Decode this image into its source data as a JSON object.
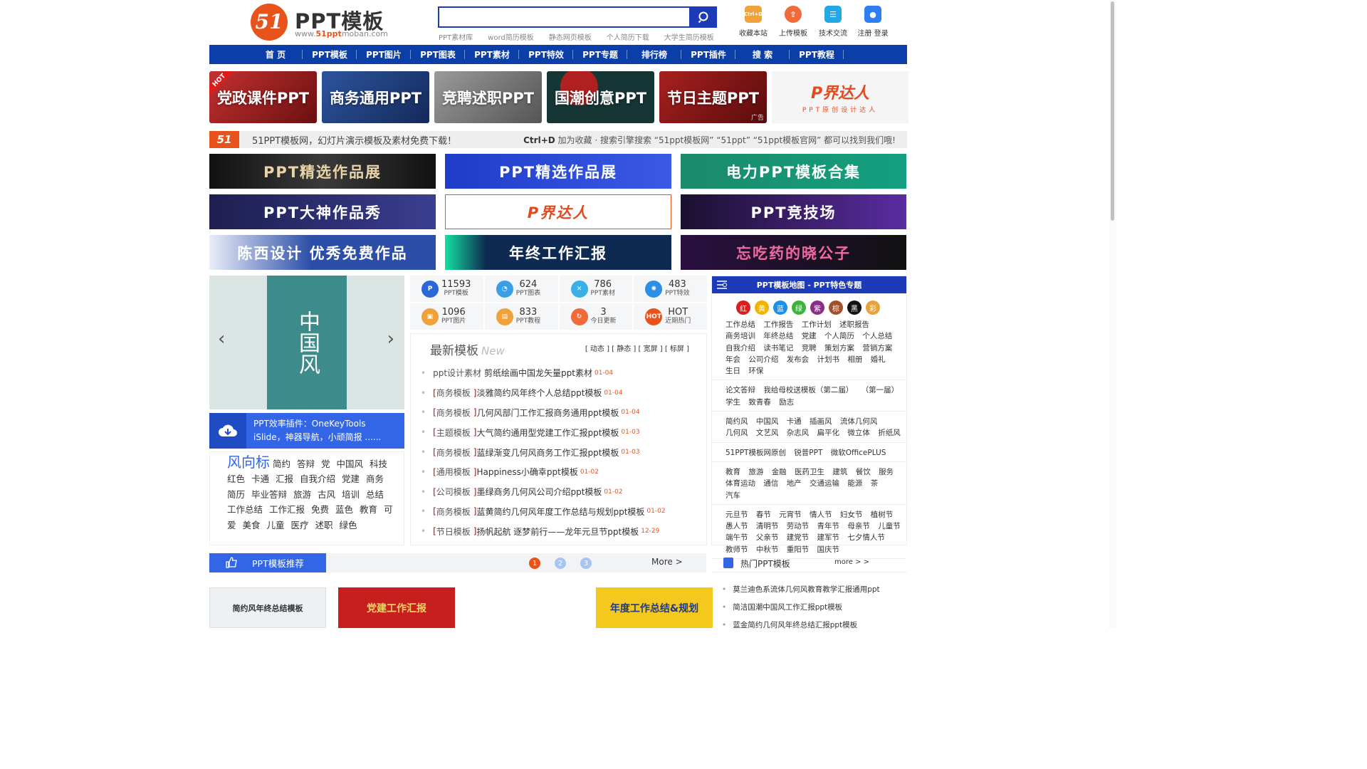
{
  "logo": {
    "mark": "51",
    "title": "PPT模板",
    "url_prefix": "www.",
    "url_brand": "51ppt",
    "url_suffix": "moban.com"
  },
  "search": {
    "value": "",
    "placeholder": ""
  },
  "hot_links": [
    "PPT素材库",
    "word简历模板",
    "静态网页模板",
    "个人简历下载",
    "大学生简历模板"
  ],
  "top_icons": [
    {
      "label": "收藏本站",
      "icon": "bookmark-icon",
      "glyph": "Ctrl+D",
      "color": "#f0a23a"
    },
    {
      "label": "上传模板",
      "icon": "upload-icon",
      "glyph": "⇧",
      "color": "#f06a3a"
    },
    {
      "label": "技术交流",
      "icon": "chat-icon",
      "glyph": "☰",
      "color": "#23a8e6"
    },
    {
      "label": "注册 登录",
      "icon": "user-icon",
      "glyph": "●",
      "color": "#2d7ef0"
    }
  ],
  "nav": [
    "首 页",
    "PPT模板",
    "PPT图片",
    "PPT图表",
    "PPT素材",
    "PPT特效",
    "PPT专题",
    "排行榜",
    "PPT插件",
    "搜 索",
    "PPT教程"
  ],
  "cat_banners": [
    {
      "label": "党政课件PPT",
      "color": "#a82222",
      "badge": "HOT"
    },
    {
      "label": "商务通用PPT",
      "color": "#1f3f7d"
    },
    {
      "label": "竞聘述职PPT",
      "color": "#6a6a6a"
    },
    {
      "label": "国潮创意PPT",
      "color": "#1c3a3a"
    },
    {
      "label": "节日主题PPT",
      "color": "#8a1818",
      "ad": "广告"
    }
  ],
  "pjdr": {
    "title": "P界达人",
    "subtitle": "PPT原创设计达人"
  },
  "slogan": {
    "logo": "51",
    "text": "51PPT模板网，幻灯片演示模板及素材免费下载！",
    "right_key": "Ctrl+D",
    "right_text": "加为收藏 · 搜索引擎搜索 “51ppt模板网” “51ppt” “51ppt模板官网” 都可以找到我们哦!"
  },
  "ad_banners": [
    {
      "label": "PPT精选作品展",
      "color": "#2a2a2a"
    },
    {
      "label": "PPT精选作品展",
      "color": "#2344c8"
    },
    {
      "label": "电力PPT模板合集",
      "color": "#1d8a6a"
    },
    {
      "label": "PPT大神作品秀",
      "color": "#2d3270"
    },
    {
      "label": "P界达人",
      "color": "#ffffff"
    },
    {
      "label": "PPT竞技场",
      "color": "#3a1f6a"
    },
    {
      "label": "陈西设计 优秀免费作品",
      "color": "#2d4ea8"
    },
    {
      "label": "年终工作汇报",
      "color": "#0f2a52"
    },
    {
      "label": "忘吃药的晓公子",
      "color": "#1a1a3a"
    }
  ],
  "slider": {
    "poster_text": "中国风",
    "prev": "‹",
    "next": "›"
  },
  "plugin": {
    "line1": "PPT效率插件：OneKeyTools",
    "line2": "iSlide，神器导航，小顽简报 ......"
  },
  "trend": {
    "title": "风向标",
    "tags": [
      "简约",
      "答辩",
      "党",
      "中国风",
      "科技",
      "红色",
      "卡通",
      "汇报",
      "自我介绍",
      "党建",
      "商务",
      "简历",
      "毕业答辩",
      "旅游",
      "古风",
      "培训",
      "总结",
      "工作总结",
      "工作汇报",
      "免费",
      "蓝色",
      "教育",
      "可爱",
      "美食",
      "儿童",
      "医疗",
      "述职",
      "绿色"
    ]
  },
  "stats": [
    {
      "num": "11593",
      "label": "PPT模板",
      "icon": "ppt-icon",
      "color": "#2d66d8",
      "glyph": "P"
    },
    {
      "num": "624",
      "label": "PPT图表",
      "icon": "pie-chart-icon",
      "color": "#3aa0e6",
      "glyph": "◔"
    },
    {
      "num": "786",
      "label": "PPT素材",
      "icon": "material-icon",
      "color": "#3ab0e6",
      "glyph": "✕"
    },
    {
      "num": "483",
      "label": "PPT特效",
      "icon": "effect-icon",
      "color": "#2d8ee6",
      "glyph": "✺"
    },
    {
      "num": "1096",
      "label": "PPT图片",
      "icon": "image-icon",
      "color": "#f0a23a",
      "glyph": "▣"
    },
    {
      "num": "833",
      "label": "PPT教程",
      "icon": "tutorial-icon",
      "color": "#f0a23a",
      "glyph": "▤"
    },
    {
      "num": "3",
      "label": "今日更新",
      "icon": "refresh-icon",
      "color": "#f06a3a",
      "glyph": "↻"
    },
    {
      "num": "HOT",
      "label": "近期热门",
      "icon": "hot-icon",
      "color": "#e8531b",
      "glyph": "HOT"
    }
  ],
  "latest": {
    "title": "最新模板",
    "subtitle": "New",
    "filters": "[ 动态 ] [ 静态 ] [ 宽屏 ] [ 标屏 ]",
    "items": [
      {
        "cat": "ppt设计素材",
        "title": "剪纸绘画中国龙矢量ppt素材",
        "date": "01-04",
        "bracket": false
      },
      {
        "cat": "商务模板",
        "title": "淡雅简约风年终个人总结ppt模板",
        "date": "01-04",
        "bracket": true
      },
      {
        "cat": "商务模板",
        "title": "几何风部门工作汇报商务通用ppt模板",
        "date": "01-04",
        "bracket": true
      },
      {
        "cat": "主题模板",
        "title": "大气简约通用型党建工作汇报ppt模板",
        "date": "01-03",
        "bracket": true
      },
      {
        "cat": "商务模板",
        "title": "蓝绿渐变几何风商务工作汇报ppt模板",
        "date": "01-03",
        "bracket": true
      },
      {
        "cat": "通用模板",
        "title": "Happiness小确幸ppt模板",
        "date": "01-02",
        "bracket": true
      },
      {
        "cat": "公司模板",
        "title": "墨绿商务几何风公司介绍ppt模板",
        "date": "01-02",
        "bracket": true
      },
      {
        "cat": "商务模板",
        "title": "蓝黄简约几何风年度工作总结与规划ppt模板",
        "date": "01-02",
        "bracket": true
      },
      {
        "cat": "节日模板",
        "title": "扬帆起航 逐梦前行——龙年元旦节ppt模板",
        "date": "12-29",
        "bracket": true
      }
    ]
  },
  "sitemap": {
    "title": "PPT模板地图 - PPT特色专题",
    "colors": [
      {
        "label": "红",
        "color": "#d81e1e"
      },
      {
        "label": "黄",
        "color": "#f0b400"
      },
      {
        "label": "蓝",
        "color": "#1e8ee6"
      },
      {
        "label": "绿",
        "color": "#3cb43c"
      },
      {
        "label": "紫",
        "color": "#8a2d8a"
      },
      {
        "label": "棕",
        "color": "#a0522d"
      },
      {
        "label": "黑",
        "color": "#111111"
      },
      {
        "label": "彩",
        "color": "#e6a23c"
      }
    ],
    "groups": [
      [
        "工作总结",
        "工作报告",
        "工作计划",
        "述职报告",
        "商务培训",
        "年终总结",
        "党建",
        "个人简历",
        "个人总结",
        "自我介绍",
        "读书笔记",
        "竞聘",
        "策划方案",
        "营销方案",
        "年会",
        "公司介绍",
        "发布会",
        "计划书",
        "相册",
        "婚礼",
        "生日",
        "环保"
      ],
      [
        "论文答辩",
        "我给母校送模板（第二届）",
        "（第一届）",
        "学生",
        "致青春",
        "励志"
      ],
      [
        "简约风",
        "中国风",
        "卡通",
        "插画风",
        "流体几何风",
        "几何风",
        "文艺风",
        "杂志风",
        "扁平化",
        "微立体",
        "折纸风"
      ],
      [
        "51PPT模板网原创",
        "锐普PPT",
        "微软OfficePLUS"
      ],
      [
        "教育",
        "旅游",
        "金融",
        "医药卫生",
        "建筑",
        "餐饮",
        "服务",
        "体育运动",
        "通信",
        "地产",
        "交通运输",
        "能源",
        "茶",
        "汽车"
      ],
      [
        "元旦节",
        "春节",
        "元宵节",
        "情人节",
        "妇女节",
        "植树节",
        "愚人节",
        "清明节",
        "劳动节",
        "青年节",
        "母亲节",
        "儿童节",
        "端午节",
        "父亲节",
        "建党节",
        "建军节",
        "七夕情人节",
        "教师节",
        "中秋节",
        "重阳节",
        "国庆节"
      ]
    ]
  },
  "recommend": {
    "title": "PPT模板推荐",
    "pages": [
      "1",
      "2",
      "3"
    ],
    "more": "More >",
    "thumbs": [
      {
        "label": "简约风年终总结模板",
        "bg": "#eef1f4",
        "fg": "#333333"
      },
      {
        "label": "党建工作汇报",
        "bg": "#c81e1e",
        "fg": "#f5d26a"
      },
      {
        "label": "",
        "bg": "#ffffff",
        "fg": "#333333"
      },
      {
        "label": "年度工作总结&规划",
        "bg": "#f5c81e",
        "fg": "#1e3a8a"
      }
    ]
  },
  "hot": {
    "title": "热门PPT模板",
    "more": "more > >",
    "items": [
      "莫兰迪色系流体几何风教育教学汇报通用ppt",
      "简洁国潮中国风工作汇报ppt模板",
      "蓝金简约几何风年终总结汇报ppt模板"
    ]
  }
}
